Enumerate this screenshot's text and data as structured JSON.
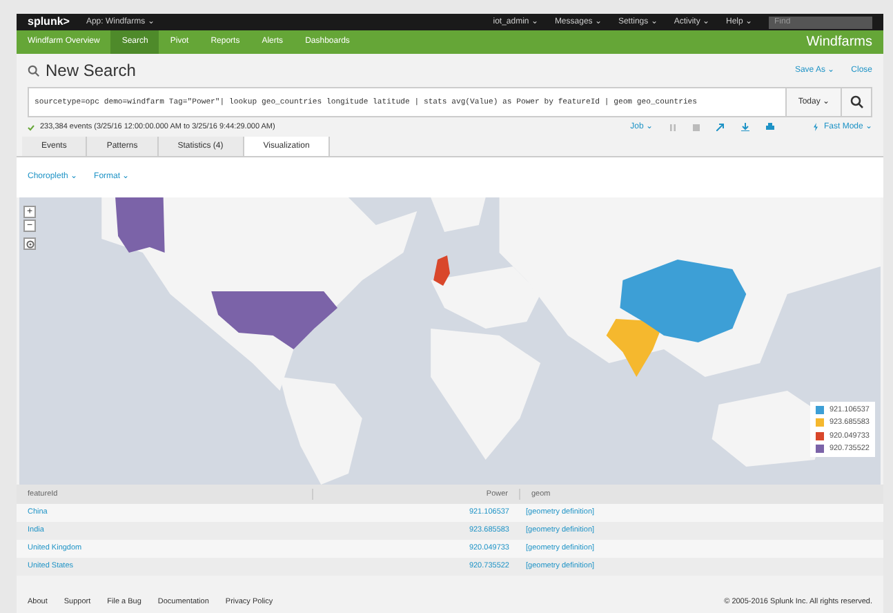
{
  "top_bar": {
    "logo": "splunk>",
    "app": "App: Windfarms ⌄",
    "menus": [
      "iot_admin ⌄",
      "Messages ⌄",
      "Settings ⌄",
      "Activity ⌄",
      "Help ⌄"
    ],
    "find_placeholder": "Find"
  },
  "nav": {
    "items": [
      {
        "label": "Windfarm Overview",
        "selected": false
      },
      {
        "label": "Search",
        "selected": true
      },
      {
        "label": "Pivot",
        "selected": false
      },
      {
        "label": "Reports",
        "selected": false
      },
      {
        "label": "Alerts",
        "selected": false
      },
      {
        "label": "Dashboards",
        "selected": false
      }
    ],
    "app_title": "Windfarms"
  },
  "page": {
    "title": "New Search",
    "actions": [
      "Save As ⌄",
      "Close"
    ]
  },
  "search": {
    "query": "sourcetype=opc demo=windfarm Tag=\"Power\"| lookup geo_countries longitude latitude | stats avg(Value) as Power by featureId | geom geo_countries",
    "time_range": "Today ⌄"
  },
  "status": {
    "events": "233,384 events (3/25/16 12:00:00.000 AM to 3/25/16 9:44:29.000 AM)",
    "job": "Job ⌄",
    "mode": "Fast Mode ⌄"
  },
  "tabs": [
    {
      "label": "Events",
      "selected": false
    },
    {
      "label": "Patterns",
      "selected": false
    },
    {
      "label": "Statistics (4)",
      "selected": false
    },
    {
      "label": "Visualization",
      "selected": true
    }
  ],
  "viz_options": [
    "Choropleth ⌄",
    "Format ⌄"
  ],
  "map": {
    "zoom_in": "+",
    "zoom_out": "−",
    "legend": [
      {
        "label": "921.106537",
        "color": "#3d9fd6"
      },
      {
        "label": "923.685583",
        "color": "#f5b82e"
      },
      {
        "label": "920.049733",
        "color": "#d9472b"
      },
      {
        "label": "920.735522",
        "color": "#7b63a8"
      }
    ]
  },
  "table": {
    "columns": [
      "featureId",
      "Power",
      "geom"
    ],
    "rows": [
      [
        "China",
        "921.106537",
        "[geometry definition]"
      ],
      [
        "India",
        "923.685583",
        "[geometry definition]"
      ],
      [
        "United Kingdom",
        "920.049733",
        "[geometry definition]"
      ],
      [
        "United States",
        "920.735522",
        "[geometry definition]"
      ]
    ]
  },
  "footer": {
    "links": [
      "About",
      "Support",
      "File a Bug",
      "Documentation",
      "Privacy Policy"
    ],
    "copyright": "© 2005-2016 Splunk Inc. All rights reserved."
  }
}
